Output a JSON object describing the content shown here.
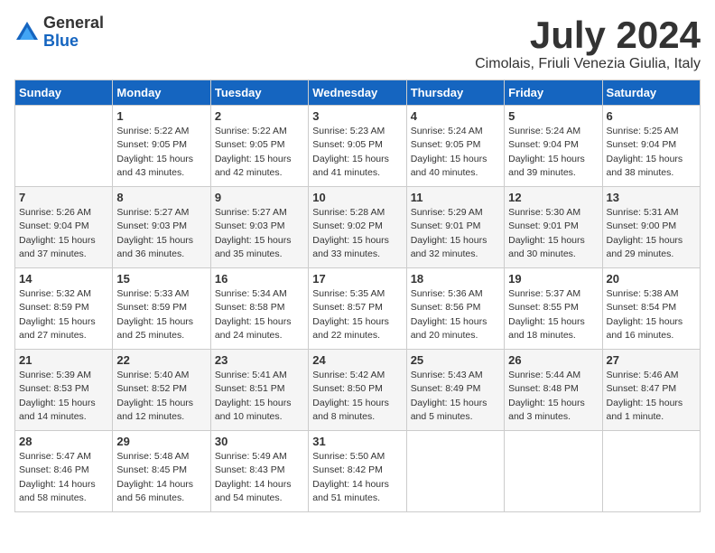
{
  "logo": {
    "general": "General",
    "blue": "Blue"
  },
  "title": "July 2024",
  "location": "Cimolais, Friuli Venezia Giulia, Italy",
  "days_of_week": [
    "Sunday",
    "Monday",
    "Tuesday",
    "Wednesday",
    "Thursday",
    "Friday",
    "Saturday"
  ],
  "weeks": [
    [
      {
        "day": "",
        "info": ""
      },
      {
        "day": "1",
        "info": "Sunrise: 5:22 AM\nSunset: 9:05 PM\nDaylight: 15 hours\nand 43 minutes."
      },
      {
        "day": "2",
        "info": "Sunrise: 5:22 AM\nSunset: 9:05 PM\nDaylight: 15 hours\nand 42 minutes."
      },
      {
        "day": "3",
        "info": "Sunrise: 5:23 AM\nSunset: 9:05 PM\nDaylight: 15 hours\nand 41 minutes."
      },
      {
        "day": "4",
        "info": "Sunrise: 5:24 AM\nSunset: 9:05 PM\nDaylight: 15 hours\nand 40 minutes."
      },
      {
        "day": "5",
        "info": "Sunrise: 5:24 AM\nSunset: 9:04 PM\nDaylight: 15 hours\nand 39 minutes."
      },
      {
        "day": "6",
        "info": "Sunrise: 5:25 AM\nSunset: 9:04 PM\nDaylight: 15 hours\nand 38 minutes."
      }
    ],
    [
      {
        "day": "7",
        "info": "Sunrise: 5:26 AM\nSunset: 9:04 PM\nDaylight: 15 hours\nand 37 minutes."
      },
      {
        "day": "8",
        "info": "Sunrise: 5:27 AM\nSunset: 9:03 PM\nDaylight: 15 hours\nand 36 minutes."
      },
      {
        "day": "9",
        "info": "Sunrise: 5:27 AM\nSunset: 9:03 PM\nDaylight: 15 hours\nand 35 minutes."
      },
      {
        "day": "10",
        "info": "Sunrise: 5:28 AM\nSunset: 9:02 PM\nDaylight: 15 hours\nand 33 minutes."
      },
      {
        "day": "11",
        "info": "Sunrise: 5:29 AM\nSunset: 9:01 PM\nDaylight: 15 hours\nand 32 minutes."
      },
      {
        "day": "12",
        "info": "Sunrise: 5:30 AM\nSunset: 9:01 PM\nDaylight: 15 hours\nand 30 minutes."
      },
      {
        "day": "13",
        "info": "Sunrise: 5:31 AM\nSunset: 9:00 PM\nDaylight: 15 hours\nand 29 minutes."
      }
    ],
    [
      {
        "day": "14",
        "info": "Sunrise: 5:32 AM\nSunset: 8:59 PM\nDaylight: 15 hours\nand 27 minutes."
      },
      {
        "day": "15",
        "info": "Sunrise: 5:33 AM\nSunset: 8:59 PM\nDaylight: 15 hours\nand 25 minutes."
      },
      {
        "day": "16",
        "info": "Sunrise: 5:34 AM\nSunset: 8:58 PM\nDaylight: 15 hours\nand 24 minutes."
      },
      {
        "day": "17",
        "info": "Sunrise: 5:35 AM\nSunset: 8:57 PM\nDaylight: 15 hours\nand 22 minutes."
      },
      {
        "day": "18",
        "info": "Sunrise: 5:36 AM\nSunset: 8:56 PM\nDaylight: 15 hours\nand 20 minutes."
      },
      {
        "day": "19",
        "info": "Sunrise: 5:37 AM\nSunset: 8:55 PM\nDaylight: 15 hours\nand 18 minutes."
      },
      {
        "day": "20",
        "info": "Sunrise: 5:38 AM\nSunset: 8:54 PM\nDaylight: 15 hours\nand 16 minutes."
      }
    ],
    [
      {
        "day": "21",
        "info": "Sunrise: 5:39 AM\nSunset: 8:53 PM\nDaylight: 15 hours\nand 14 minutes."
      },
      {
        "day": "22",
        "info": "Sunrise: 5:40 AM\nSunset: 8:52 PM\nDaylight: 15 hours\nand 12 minutes."
      },
      {
        "day": "23",
        "info": "Sunrise: 5:41 AM\nSunset: 8:51 PM\nDaylight: 15 hours\nand 10 minutes."
      },
      {
        "day": "24",
        "info": "Sunrise: 5:42 AM\nSunset: 8:50 PM\nDaylight: 15 hours\nand 8 minutes."
      },
      {
        "day": "25",
        "info": "Sunrise: 5:43 AM\nSunset: 8:49 PM\nDaylight: 15 hours\nand 5 minutes."
      },
      {
        "day": "26",
        "info": "Sunrise: 5:44 AM\nSunset: 8:48 PM\nDaylight: 15 hours\nand 3 minutes."
      },
      {
        "day": "27",
        "info": "Sunrise: 5:46 AM\nSunset: 8:47 PM\nDaylight: 15 hours\nand 1 minute."
      }
    ],
    [
      {
        "day": "28",
        "info": "Sunrise: 5:47 AM\nSunset: 8:46 PM\nDaylight: 14 hours\nand 58 minutes."
      },
      {
        "day": "29",
        "info": "Sunrise: 5:48 AM\nSunset: 8:45 PM\nDaylight: 14 hours\nand 56 minutes."
      },
      {
        "day": "30",
        "info": "Sunrise: 5:49 AM\nSunset: 8:43 PM\nDaylight: 14 hours\nand 54 minutes."
      },
      {
        "day": "31",
        "info": "Sunrise: 5:50 AM\nSunset: 8:42 PM\nDaylight: 14 hours\nand 51 minutes."
      },
      {
        "day": "",
        "info": ""
      },
      {
        "day": "",
        "info": ""
      },
      {
        "day": "",
        "info": ""
      }
    ]
  ]
}
